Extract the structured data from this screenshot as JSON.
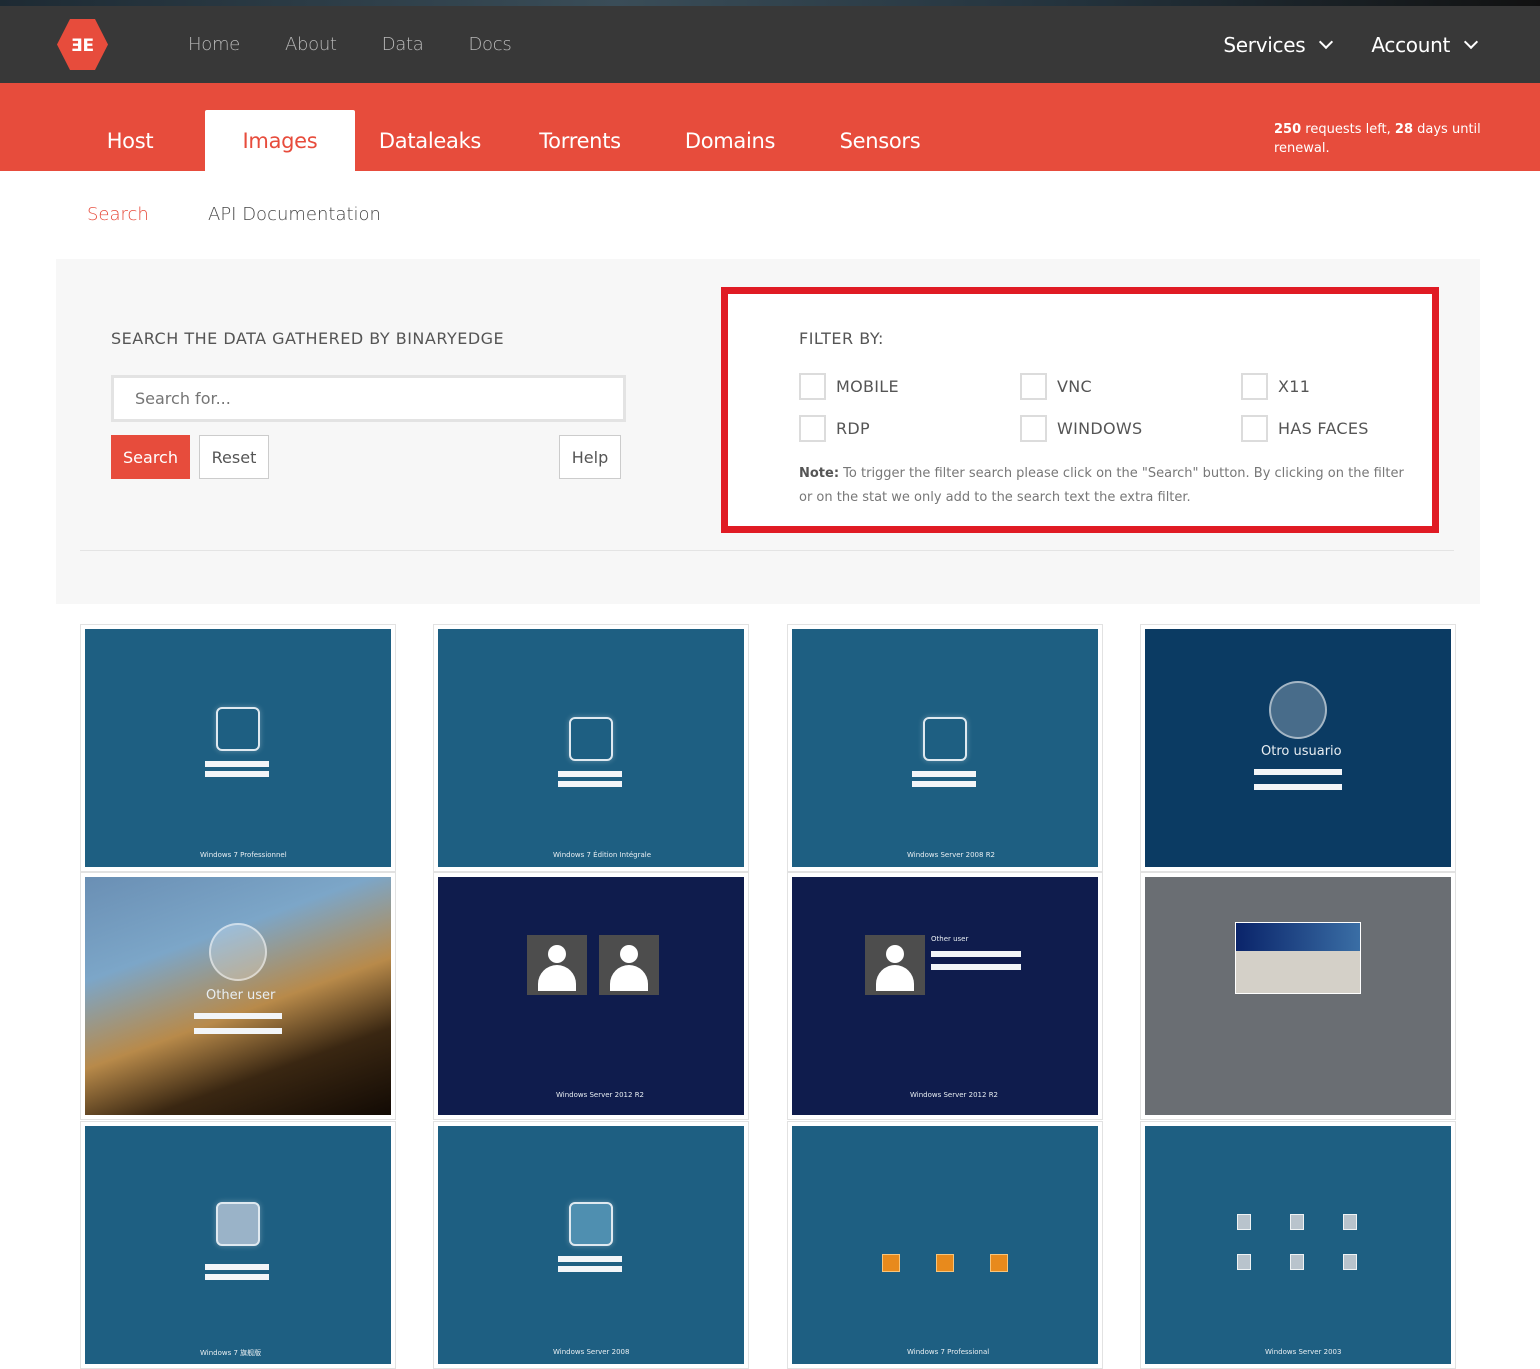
{
  "nav": {
    "logo": "be-logo",
    "links": [
      "Home",
      "About",
      "Data",
      "Docs"
    ],
    "services_label": "Services",
    "account_label": "Account"
  },
  "tabs": [
    "Host",
    "Images",
    "Dataleaks",
    "Torrents",
    "Domains",
    "Sensors"
  ],
  "active_tab": "Images",
  "quota": {
    "requests": "250",
    "requests_text": " requests left, ",
    "days": "28",
    "days_text": " days until renewal."
  },
  "subnav": {
    "search_label": "Search",
    "api_label": "API Documentation"
  },
  "search": {
    "title": "SEARCH THE DATA GATHERED BY BINARYEDGE",
    "placeholder": "Search for...",
    "search_button": "Search",
    "reset_button": "Reset",
    "help_button": "Help"
  },
  "filter": {
    "title": "FILTER BY:",
    "options": [
      "MOBILE",
      "VNC",
      "X11",
      "RDP",
      "WINDOWS",
      "HAS FACES"
    ],
    "note_label": "Note:",
    "note_text": " To trigger the filter search please click on the \"Search\" button. By clicking on the filter or on the stat we only add to the search text the extra filter."
  },
  "gallery": {
    "captions": {
      "t4_user": "Otro usuario",
      "t5_user": "Other user",
      "t6_os": "Windows Server 2012 R2",
      "t7_user": "Other user",
      "t7_os": "Windows Server 2012 R2",
      "t1_os": "Windows 7 Professionnel",
      "t2_os": "Windows 7 Édition Intégrale",
      "t3_os": "Windows Server 2008 R2",
      "t9_os": "Windows 7 旗舰版",
      "t10_os": "Windows Server 2008",
      "t11_os": "Windows 7 Professional",
      "t12_os": "Windows Server 2003"
    }
  },
  "colors": {
    "navbar": "#383838",
    "accent": "#e74c3c",
    "highlight_border": "#e01b24"
  }
}
